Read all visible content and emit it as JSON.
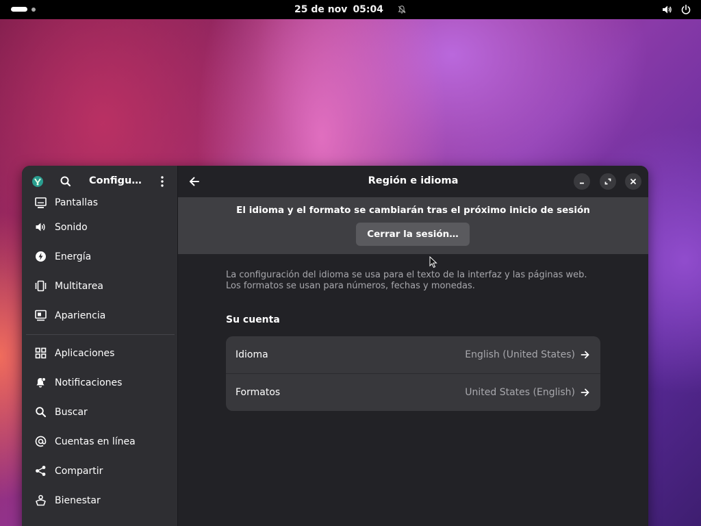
{
  "topbar": {
    "date": "25 de nov",
    "time": "05:04"
  },
  "sidebar": {
    "title": "Configu…",
    "items_top": [
      {
        "label": "Pantallas",
        "icon": "display-icon"
      },
      {
        "label": "Sonido",
        "icon": "speaker-icon"
      },
      {
        "label": "Energía",
        "icon": "power-bolt-icon"
      },
      {
        "label": "Multitarea",
        "icon": "multitask-icon"
      },
      {
        "label": "Apariencia",
        "icon": "appearance-icon"
      }
    ],
    "items_bottom": [
      {
        "label": "Aplicaciones",
        "icon": "apps-grid-icon"
      },
      {
        "label": "Notificaciones",
        "icon": "notifications-icon"
      },
      {
        "label": "Buscar",
        "icon": "search-icon"
      },
      {
        "label": "Cuentas en línea",
        "icon": "at-sign-icon"
      },
      {
        "label": "Compartir",
        "icon": "share-icon"
      },
      {
        "label": "Bienestar",
        "icon": "wellbeing-icon"
      }
    ]
  },
  "header": {
    "title": "Región e idioma"
  },
  "banner": {
    "text": "El idioma y el formato se cambiarán tras el próximo inicio de sesión",
    "button_label": "Cerrar la sesión…"
  },
  "description": {
    "line1": "La configuración del idioma se usa para el texto de la interfaz y las páginas web.",
    "line2": "Los formatos se usan para números, fechas y monedas."
  },
  "account": {
    "section_title": "Su cuenta",
    "rows": [
      {
        "label": "Idioma",
        "value": "English (United States)"
      },
      {
        "label": "Formatos",
        "value": "United States (English)"
      }
    ]
  },
  "colors": {
    "window_bg": "#222226",
    "sidebar_bg": "#2e2e32",
    "banner_bg": "#3f3f43",
    "row_bg": "#38383c",
    "dim_text": "#a8a8ad"
  }
}
